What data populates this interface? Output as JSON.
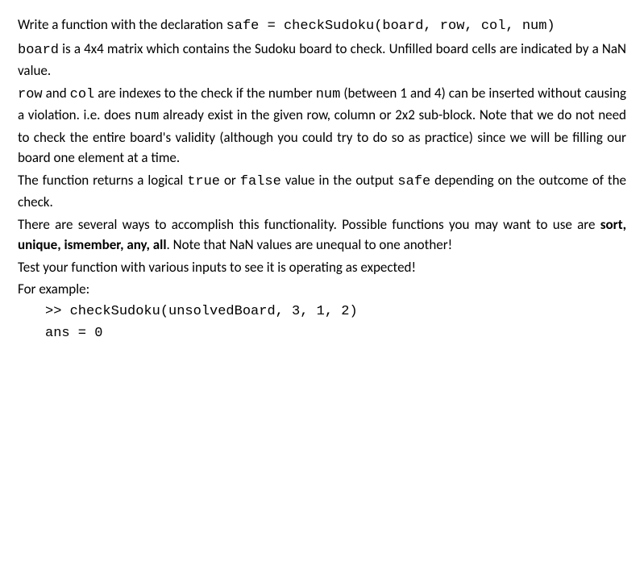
{
  "p1": {
    "t1": "Write  a  function  with  the  declaration  ",
    "c1": "safe  =  checkSudoku(board,  row, col, num)"
  },
  "p2": {
    "c1": "board",
    "t1": " is a 4x4 matrix which contains the Sudoku board to check.   Unfilled board cells are indicated by a NaN value."
  },
  "p3": {
    "c1": "row",
    "t1": " and ",
    "c2": "col",
    "t2": " are indexes to the check if the number ",
    "c3": "num",
    "t3": " (between 1 and 4) can be inserted  without  causing  a  violation.    i.e.  does  ",
    "c4": "num",
    "t4": "  already  exist  in  the  given row,  column or 2x2 sub-block.  Note that we do not need to check the entire board's validity (although  you  could  try  to  do  so  as  practice)  since  we  will  be  filling  our board  one  element at a time."
  },
  "p4": {
    "t1": "The function returns a logical ",
    "c1": "true",
    "t2": " or ",
    "c2": "false",
    "t3": " value in the output ",
    "c3": "safe",
    "t4": " depending on the outcome of the check."
  },
  "p5": {
    "t1": "There  are  several  ways  to  accomplish  this  functionality.    Possible  functions  you  may want to use are ",
    "b1": "sort, unique, ismember, any, all",
    "t2": ".  Note that NaN values are unequal to one another!"
  },
  "p6": "Test your function with various inputs to see it is operating as expected!",
  "p7": "For example:",
  "ex1": ">> checkSudoku(unsolvedBoard, 3, 1, 2)",
  "ex2": "ans = 0"
}
